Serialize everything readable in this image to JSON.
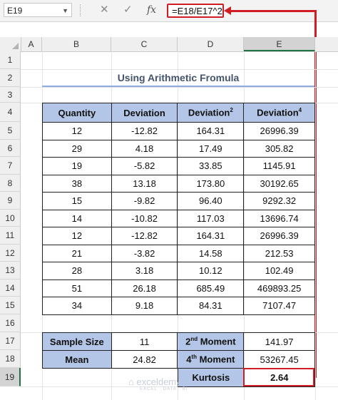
{
  "formula_bar": {
    "name_box": "E19",
    "cancel_icon": "✕",
    "enter_icon": "✓",
    "fx_label": "fx",
    "formula": "=E18/E17^2"
  },
  "columns": [
    "A",
    "B",
    "C",
    "D",
    "E"
  ],
  "rows": [
    "1",
    "2",
    "3",
    "4",
    "5",
    "6",
    "7",
    "8",
    "9",
    "10",
    "11",
    "12",
    "13",
    "14",
    "15",
    "16",
    "17",
    "18",
    "19"
  ],
  "title": "Using Arithmetic Fromula",
  "table": {
    "headers": {
      "quantity": "Quantity",
      "deviation": "Deviation",
      "deviation_sq": "Deviation",
      "deviation_sq_sup": "2",
      "deviation_4": "Deviation",
      "deviation_4_sup": "4"
    },
    "rows": [
      [
        "12",
        "-12.82",
        "164.31",
        "26996.39"
      ],
      [
        "29",
        "4.18",
        "17.49",
        "305.82"
      ],
      [
        "19",
        "-5.82",
        "33.85",
        "1145.91"
      ],
      [
        "38",
        "13.18",
        "173.80",
        "30192.65"
      ],
      [
        "15",
        "-9.82",
        "96.40",
        "9292.32"
      ],
      [
        "14",
        "-10.82",
        "117.03",
        "13696.74"
      ],
      [
        "12",
        "-12.82",
        "164.31",
        "26996.39"
      ],
      [
        "21",
        "-3.82",
        "14.58",
        "212.53"
      ],
      [
        "28",
        "3.18",
        "10.12",
        "102.49"
      ],
      [
        "51",
        "26.18",
        "685.49",
        "469893.25"
      ],
      [
        "34",
        "9.18",
        "84.31",
        "7107.47"
      ]
    ]
  },
  "stats": {
    "sample_size_label": "Sample Size",
    "sample_size_value": "11",
    "mean_label": "Mean",
    "mean_value": "24.82",
    "moment2_label_pre": "2",
    "moment2_label_sup": "nd",
    "moment2_label_post": " Moment",
    "moment2_value": "141.97",
    "moment4_label_pre": "4",
    "moment4_label_sup": "th",
    "moment4_label_post": " Moment",
    "moment4_value": "53267.45",
    "kurtosis_label": "Kurtosis",
    "kurtosis_value": "2.64"
  },
  "watermark": {
    "brand": "exceldemy",
    "tagline": "EXCEL · DATA · BI"
  },
  "colors": {
    "header_fill": "#b4c6e7",
    "highlight_red": "#d01c24",
    "excel_green": "#217346",
    "title_color": "#44546a"
  }
}
